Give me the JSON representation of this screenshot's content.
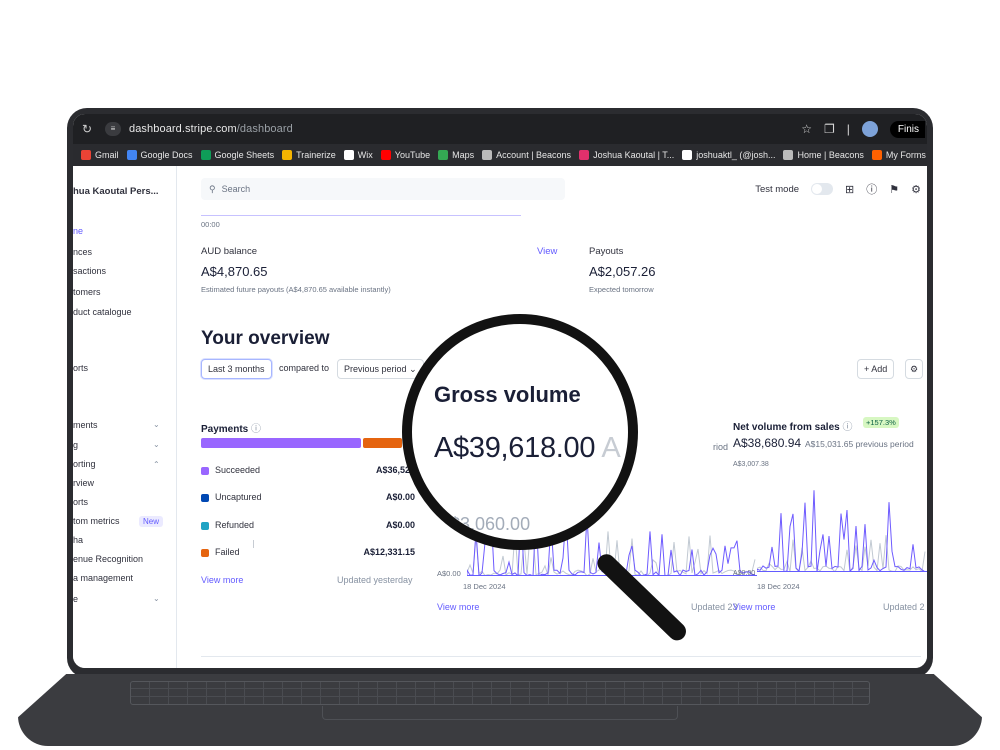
{
  "browser": {
    "url_domain": "dashboard.stripe.com",
    "url_path": "/dashboard",
    "profile_button": "Finis",
    "bookmarks": [
      {
        "label": "Gmail",
        "color": "#ea4335"
      },
      {
        "label": "Google Docs",
        "color": "#4285f4"
      },
      {
        "label": "Google Sheets",
        "color": "#0f9d58"
      },
      {
        "label": "Trainerize",
        "color": "#f5b400"
      },
      {
        "label": "Wix",
        "color": "#ffffff"
      },
      {
        "label": "YouTube",
        "color": "#ff0000"
      },
      {
        "label": "Maps",
        "color": "#34a853"
      },
      {
        "label": "Account | Beacons",
        "color": "#bbbbbb"
      },
      {
        "label": "Joshua Kaoutal | T...",
        "color": "#e1306c"
      },
      {
        "label": "joshuaktl_ (@josh...",
        "color": "#ffffff"
      },
      {
        "label": "Home | Beacons",
        "color": "#bbbbbb"
      },
      {
        "label": "My Forms | Jotform",
        "color": "#ff6100"
      }
    ]
  },
  "sidebar": {
    "account": "hua Kaoutal Pers...",
    "items": [
      {
        "label": "ne",
        "top": 0
      },
      {
        "label": "nces"
      },
      {
        "label": "sactions"
      },
      {
        "label": "tomers"
      },
      {
        "label": "duct catalogue"
      },
      {
        "label": "orts"
      },
      {
        "label": "ments"
      },
      {
        "label": "g"
      },
      {
        "label": "orting"
      },
      {
        "label": "rview"
      },
      {
        "label": "orts"
      },
      {
        "label": "tom metrics"
      },
      {
        "label": "ha"
      },
      {
        "label": "enue Recognition"
      },
      {
        "label": "a management"
      },
      {
        "label": "e"
      }
    ],
    "new_badge": "New"
  },
  "header": {
    "search_placeholder": "Search",
    "test_mode": "Test mode"
  },
  "balance": {
    "time_start": "00:00",
    "aud_label": "AUD balance",
    "aud_value": "A$4,870.65",
    "aud_note": "Estimated future payouts (A$4,870.65 available instantly)",
    "view_link": "View",
    "payouts_label": "Payouts",
    "payouts_value": "A$2,057.26",
    "payouts_note": "Expected tomorrow"
  },
  "overview": {
    "title": "Your overview",
    "range_button": "Last 3 months",
    "compared_to": "compared to",
    "compare_select": "Previous period",
    "add_button": "+ Add"
  },
  "payments": {
    "title": "Payments",
    "bar": {
      "succeeded_fraction": 0.748,
      "failed_fraction": 0.18
    },
    "rows": [
      {
        "name": "Succeeded",
        "value": "A$36,525",
        "color": "#9966ff"
      },
      {
        "name": "Uncaptured",
        "value": "A$0.00",
        "color": "#0048b3"
      },
      {
        "name": "Refunded",
        "value": "A$0.00",
        "color": "#1fa3c4"
      },
      {
        "name": "Failed",
        "value": "A$12,331.15",
        "color": "#e5640f"
      }
    ],
    "view_more": "View more",
    "updated": "Updated yesterday"
  },
  "gross_volume": {
    "partial_label": "riod",
    "axis_zero": "A$0.00",
    "date": "18 Dec 2024",
    "view_more": "View more",
    "updated": "Updated 23"
  },
  "net_volume": {
    "title": "Net volume from sales",
    "change_badge": "+157.3%",
    "value": "A$38,680.94",
    "previous": "A$15,031.65 previous period",
    "axis_top": "A$3,007.38",
    "axis_zero": "A$0.00",
    "date": "18 Dec 2024",
    "view_more": "View more",
    "updated": "Updated 2"
  },
  "magnifier": {
    "title": "Gross volume",
    "value": "A$39,618.00",
    "value_ghost": "A",
    "axis_value": "A$3,060.00"
  },
  "colors": {
    "accent": "#635bff",
    "current_series": "#6e5bff",
    "previous_series": "#c1c9d2"
  }
}
